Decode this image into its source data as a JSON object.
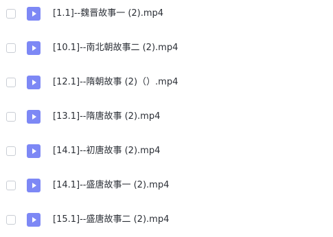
{
  "file_list": {
    "items": [
      {
        "name": "[1.1]--魏晋故事一 (2).mp4",
        "icon": "video-file-icon",
        "checked": false
      },
      {
        "name": "[10.1]--南北朝故事二 (2).mp4",
        "icon": "video-file-icon",
        "checked": false
      },
      {
        "name": "[12.1]--隋朝故事 (2)（）.mp4",
        "icon": "video-file-icon",
        "checked": false
      },
      {
        "name": "[13.1]--隋唐故事 (2).mp4",
        "icon": "video-file-icon",
        "checked": false
      },
      {
        "name": "[14.1]--初唐故事 (2).mp4",
        "icon": "video-file-icon",
        "checked": false
      },
      {
        "name": "[14.1]--盛唐故事一 (2).mp4",
        "icon": "video-file-icon",
        "checked": false
      },
      {
        "name": "[15.1]--盛唐故事二 (2).mp4",
        "icon": "video-file-icon",
        "checked": false
      }
    ]
  },
  "colors": {
    "icon_fill": "#7d88f5",
    "checkbox_border": "#c9cdd4",
    "text": "#2b2f36"
  }
}
